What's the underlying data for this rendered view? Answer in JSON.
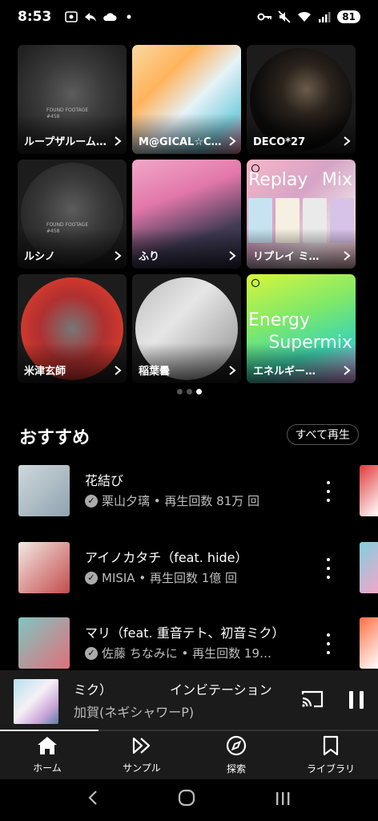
{
  "status": {
    "time": "8:53",
    "battery": "81"
  },
  "grid": [
    {
      "label": "ループザルーム…",
      "art": "found",
      "circle": false,
      "caption": "FOUND FOOTAGE\n#458"
    },
    {
      "label": "M@GICAL☆CU…",
      "art": "miku",
      "circle": false
    },
    {
      "label": "DECO*27",
      "art": "deco",
      "circle": true
    },
    {
      "label": "ルシノ",
      "art": "found",
      "circle": true,
      "caption": "FOUND FOOTAGE\n#458"
    },
    {
      "label": "ふり",
      "art": "furi",
      "circle": false
    },
    {
      "label": "リプレイ ミ…",
      "art": "replay",
      "circle": false,
      "mix_words": [
        "Replay",
        "Mix"
      ]
    },
    {
      "label": "米津玄師",
      "art": "yonezu",
      "circle": true
    },
    {
      "label": "稲葉曇",
      "art": "inaba",
      "circle": true
    },
    {
      "label": "エネルギー…",
      "art": "energy",
      "circle": false,
      "mix_words": [
        "Energy",
        "Supermix"
      ]
    }
  ],
  "pager": {
    "count": 3,
    "active": 2
  },
  "section": {
    "title": "おすすめ",
    "play_all": "すべて再生"
  },
  "songs": [
    {
      "title": "花結び",
      "meta": "栗山夕璃 • 再生回数 81万 回",
      "thumb": [
        "#cfd8dc",
        "#8fa3b0"
      ],
      "peek": [
        "#e03a3a",
        "#ffffff"
      ]
    },
    {
      "title": "アイノカタチ（feat. hide）",
      "meta": "MISIA • 再生回数 1億 回",
      "thumb": [
        "#f3e9e4",
        "#c34b4b"
      ],
      "peek": [
        "#7fd0e0",
        "#f3a6c8"
      ]
    },
    {
      "title": "マリ（feat. 重音テト、初音ミク）",
      "meta": "佐藤 ちなみに • 再生回数 19…",
      "thumb": [
        "#7fc6c2",
        "#e0707a"
      ],
      "peek": [
        "#ff7043",
        "#ffffff"
      ]
    }
  ],
  "mini_player": {
    "title": "ミク）　　　　　インビテーション",
    "artist": "加賀(ネギシャワーP)",
    "progress_pct": 26
  },
  "nav": [
    {
      "label": "ホーム",
      "icon": "home-icon"
    },
    {
      "label": "サンプル",
      "icon": "samples-icon"
    },
    {
      "label": "探索",
      "icon": "explore-icon"
    },
    {
      "label": "ライブラリ",
      "icon": "library-icon"
    }
  ],
  "colors": {
    "accent_progress": "#ffffff"
  }
}
